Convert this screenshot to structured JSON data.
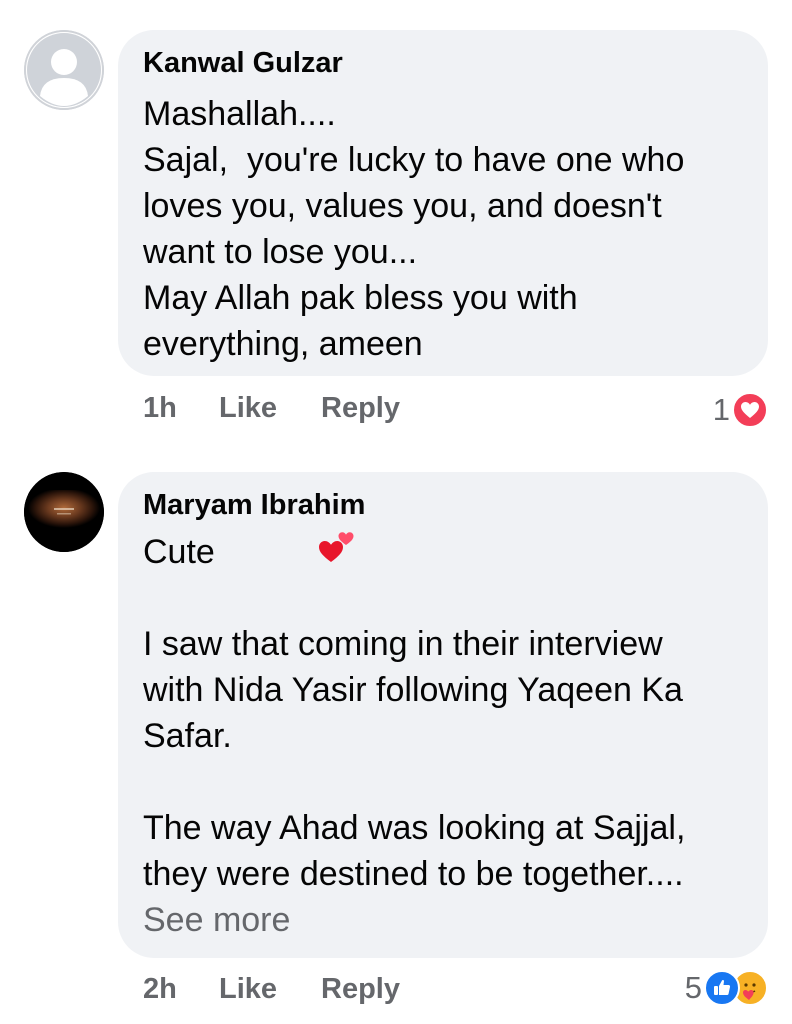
{
  "comments": [
    {
      "author": "Kanwal Gulzar",
      "lines": [
        "Mashallah....",
        "Sajal,  you're lucky to have one who",
        "loves you, values you, and doesn't",
        "want to lose you...",
        "May Allah pak bless you with",
        "everything, ameen"
      ],
      "time": "1h",
      "like_label": "Like",
      "reply_label": "Reply",
      "reaction_count": "1",
      "reaction_icons": [
        "love-icon"
      ]
    },
    {
      "author": "Maryam Ibrahim",
      "lines": [
        "Cute",
        "",
        "I saw that coming in their interview",
        "with Nida Yasir following Yaqeen Ka",
        "Safar.",
        "",
        "The way Ahad was looking at Sajjal,",
        "they were destined to be together...."
      ],
      "see_more": "See more",
      "time": "2h",
      "like_label": "Like",
      "reply_label": "Reply",
      "reaction_count": "5",
      "reaction_icons": [
        "like-icon",
        "care-icon"
      ]
    }
  ],
  "colors": {
    "bubble": "#f0f2f5",
    "meta_text": "#65676b",
    "love": "#f33e58",
    "like": "#1877f2",
    "care": "#f7b125"
  }
}
